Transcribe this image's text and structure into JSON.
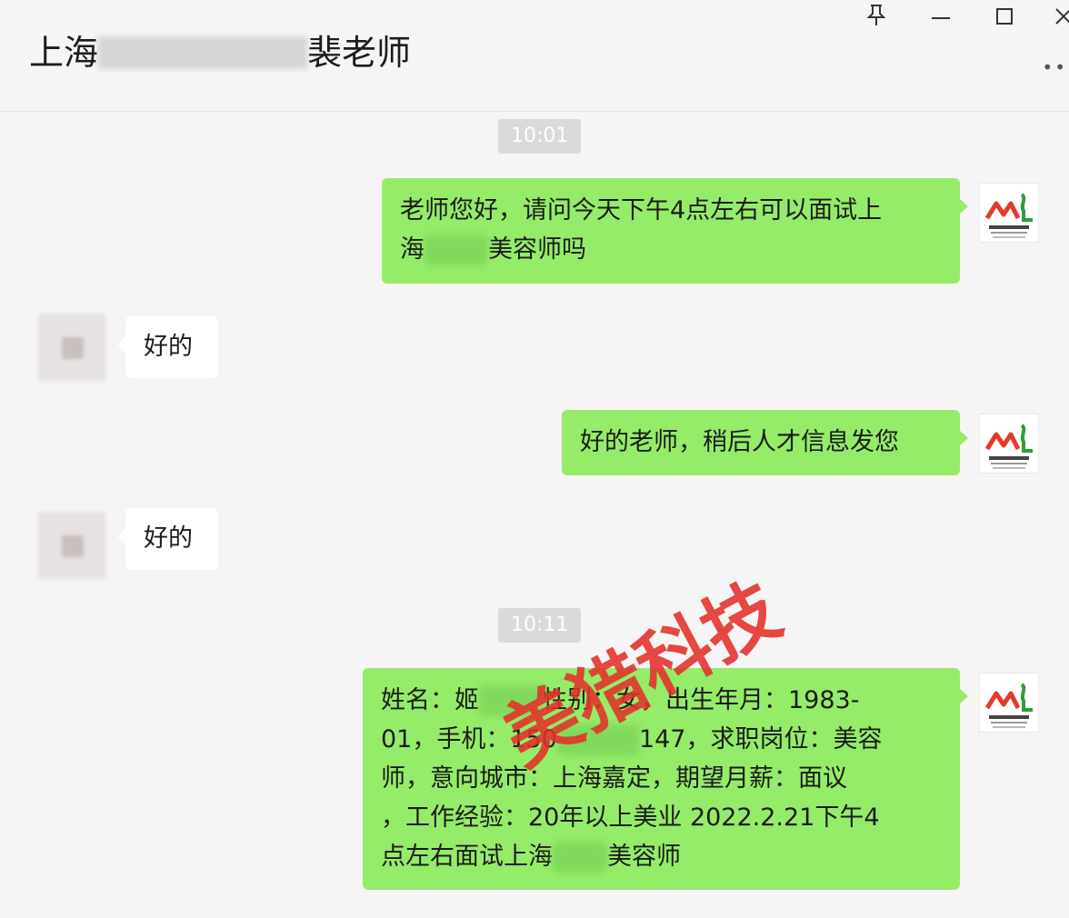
{
  "header": {
    "title_prefix": "上海",
    "title_suffix": "裴老师",
    "controls": {
      "pin_icon": "pin-icon",
      "minimize_icon": "minimize-icon",
      "maximize_icon": "maximize-icon",
      "close_icon": "close-icon",
      "more_icon": "more-icon"
    }
  },
  "messages": [
    {
      "type": "time",
      "text": "10:01"
    },
    {
      "type": "me",
      "lines": [
        "老师您好，请问今天下午4点左右可以面试上",
        "海",
        "美容师吗"
      ]
    },
    {
      "type": "them",
      "text": "好的"
    },
    {
      "type": "me",
      "text": "好的老师，稍后人才信息发您"
    },
    {
      "type": "them",
      "text": "好的"
    },
    {
      "type": "time",
      "text": "10:11"
    },
    {
      "type": "me",
      "lines": [
        "姓名：姬",
        "性别：女，出生年月：1983-",
        "01，手机：150",
        "147，求职岗位：美容",
        "师，意向城市：上海嘉定，期望月薪：面议",
        "，工作经验：20年以上美业 2022.2.21下午4",
        "点左右面试上海",
        "美容师"
      ]
    }
  ],
  "watermark": "美猎科技",
  "colors": {
    "my_bubble": "#95ec69",
    "their_bubble": "#ffffff",
    "background": "#f5f5f5",
    "watermark": "#e5302a"
  }
}
